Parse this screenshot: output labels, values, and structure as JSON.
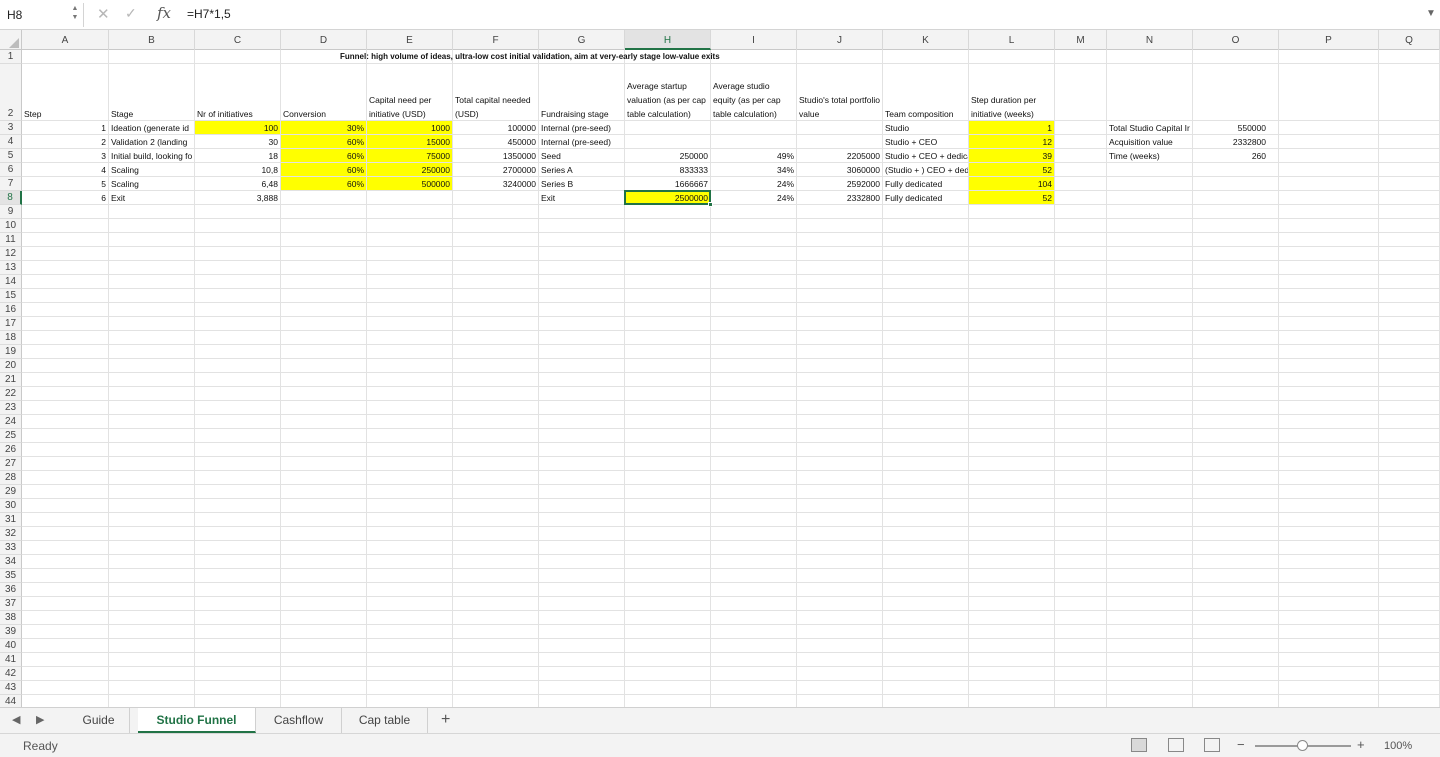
{
  "formula_bar": {
    "name_box": "H8",
    "cancel_glyph": "✕",
    "accept_glyph": "✓",
    "fx_label": "fx",
    "formula": "=H7*1,5"
  },
  "columns": [
    "A",
    "B",
    "C",
    "D",
    "E",
    "F",
    "G",
    "H",
    "I",
    "J",
    "K",
    "L",
    "M",
    "N",
    "O",
    "P",
    "Q"
  ],
  "active_column": "H",
  "active_row": 8,
  "sheet": {
    "title": "Funnel: high volume of ideas, ultra-low cost initial validation, aim at very-early stage low-value exits",
    "headers": {
      "A": "Step",
      "B": "Stage",
      "C": "Nr of initiatives",
      "D": "Conversion",
      "E": "Capital need per initiative (USD)",
      "F": "Total capital needed (USD)",
      "G": "Fundraising stage",
      "H": "Average startup valuation (as per cap table calculation)",
      "I": "Average studio equity (as per cap table calculation)",
      "J": "Studio's total portfolio value",
      "K": "Team composition",
      "L": "Step duration per initiative (weeks)"
    },
    "rows": [
      {
        "row": 3,
        "A": "1",
        "B": "Ideation (generate id",
        "C": "100",
        "D": "30%",
        "E": "1000",
        "F": "100000",
        "G": "Internal (pre-seed)",
        "H": "",
        "I": "",
        "J": "",
        "K": "Studio",
        "L": "1"
      },
      {
        "row": 4,
        "A": "2",
        "B": "Validation 2 (landing",
        "C": "30",
        "D": "60%",
        "E": "15000",
        "F": "450000",
        "G": "Internal (pre-seed)",
        "H": "",
        "I": "",
        "J": "",
        "K": "Studio + CEO",
        "L": "12"
      },
      {
        "row": 5,
        "A": "3",
        "B": "Initial build, looking fo",
        "C": "18",
        "D": "60%",
        "E": "75000",
        "F": "1350000",
        "G": "Seed",
        "H": "250000",
        "I": "49%",
        "J": "2205000",
        "K": "Studio + CEO + dedica",
        "L": "39"
      },
      {
        "row": 6,
        "A": "4",
        "B": "Scaling",
        "C": "10,8",
        "D": "60%",
        "E": "250000",
        "F": "2700000",
        "G": "Series A",
        "H": "833333",
        "I": "34%",
        "J": "3060000",
        "K": "(Studio + ) CEO + ded",
        "L": "52"
      },
      {
        "row": 7,
        "A": "5",
        "B": "Scaling",
        "C": "6,48",
        "D": "60%",
        "E": "500000",
        "F": "3240000",
        "G": "Series B",
        "H": "1666667",
        "I": "24%",
        "J": "2592000",
        "K": "Fully dedicated",
        "L": "104"
      },
      {
        "row": 8,
        "A": "6",
        "B": "Exit",
        "C": "3,888",
        "D": "",
        "E": "",
        "F": "",
        "G": "Exit",
        "H": "2500000",
        "I": "24%",
        "J": "2332800",
        "K": "Fully dedicated",
        "L": "52"
      }
    ],
    "summary": [
      {
        "label": "Total Studio Capital Ir",
        "value": "550000"
      },
      {
        "label": "Acquisition value",
        "value": "2332800"
      },
      {
        "label": "Time (weeks)",
        "value": "260"
      }
    ],
    "highlight_color": "#ffff00"
  },
  "row_numbers_count": 44,
  "tabs": {
    "nav_prev": "◀",
    "nav_next": "▶",
    "items": [
      {
        "label": "Guide",
        "active": false
      },
      {
        "label": "Studio Funnel",
        "active": true
      },
      {
        "label": "Cashflow",
        "active": false
      },
      {
        "label": "Cap table",
        "active": false
      }
    ],
    "add_label": "+"
  },
  "status": {
    "text": "Ready",
    "zoom_minus": "−",
    "zoom_plus": "+",
    "zoom_level": "100%",
    "zoom_percent": 100
  },
  "colors": {
    "accent": "#217346",
    "highlight": "#ffff00"
  }
}
